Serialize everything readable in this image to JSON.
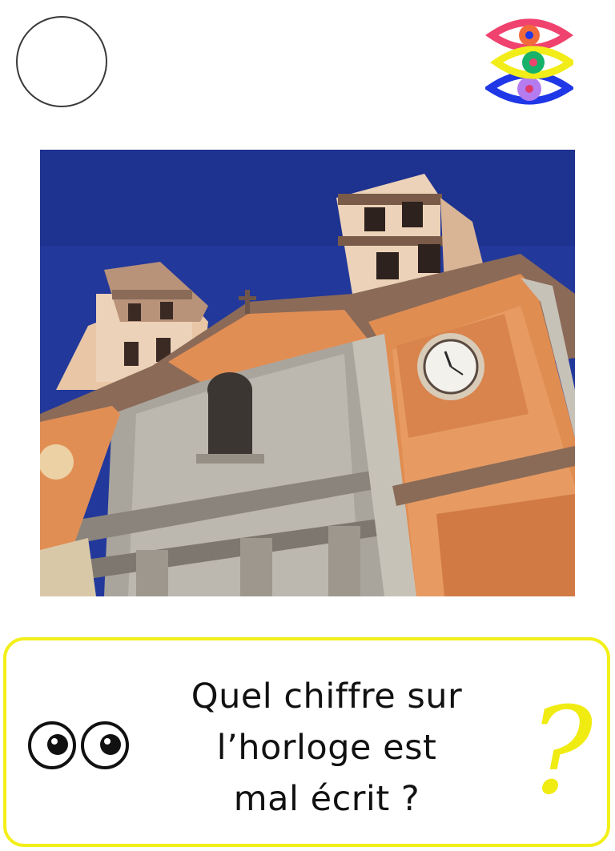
{
  "header": {
    "placeholder_circle": "empty-circle",
    "logo_icon": "stacked-eyes-logo",
    "logo_colors": [
      "#f0426e",
      "#f2ec18",
      "#1f37e6",
      "#b57cf0",
      "#17b26a"
    ]
  },
  "photo": {
    "subject": "church-facade-with-clock-tower",
    "sky_color": "#22389a",
    "tower_color": "#e4945a"
  },
  "card": {
    "question": "Quel chiffre sur\nl’horloge est\nmal écrit ?",
    "question_mark": "?",
    "eyes_icon": "googly-eyes-icon",
    "accent_color": "#f3ef1a"
  }
}
